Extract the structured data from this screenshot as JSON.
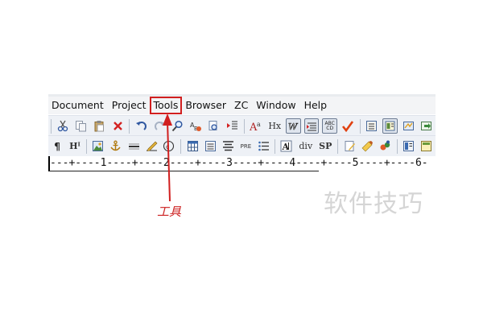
{
  "menubar": {
    "items": [
      {
        "label": "Document"
      },
      {
        "label": "Project"
      },
      {
        "label": "Tools"
      },
      {
        "label": "Browser"
      },
      {
        "label": "ZC"
      },
      {
        "label": "Window"
      },
      {
        "label": "Help"
      }
    ],
    "highlighted_item": "Tools",
    "highlight_color": "#d11f1f"
  },
  "toolbar_row_1": {
    "icons": [
      "cut-icon",
      "copy-icon",
      "paste-icon",
      "delete-icon",
      "undo-icon",
      "redo-icon",
      "find-icon",
      "replace-icon",
      "find-in-files-icon",
      "indent-icon",
      "font-size-icon",
      "hx-heading-icon",
      "word-wrap-icon",
      "line-numbers-icon",
      "spell-check-abc-icon",
      "checkmark-icon",
      "panel-icon",
      "panel-active-icon",
      "preview-icon",
      "export-icon"
    ],
    "text_labels": {
      "hx": "Hx",
      "abc_top": "ABC",
      "abc_bottom": "CD"
    }
  },
  "toolbar_row_2": {
    "icons": [
      "pilcrow-icon",
      "heading-icon",
      "image-icon",
      "anchor-icon",
      "horizontal-rule-icon",
      "edit-icon",
      "copyright-icon",
      "table-icon",
      "list-icon",
      "center-align-icon",
      "pre-icon",
      "bullet-list-icon",
      "font-icon",
      "div-icon",
      "sp-icon",
      "notes-icon",
      "brush-icon",
      "snippet-icon",
      "panel-icon",
      "panel-yellow-icon"
    ],
    "text_labels": {
      "pilcrow": "¶",
      "hi": "Hᴵ",
      "pre": "PRE",
      "div": "div",
      "sp": "SP"
    }
  },
  "ruler": {
    "text": "---+----1----+----2----+----3----+----4----+----5----+----6-"
  },
  "annotation": {
    "label": "工具",
    "color": "#cc1f1f"
  },
  "watermark": {
    "text": "软件技巧"
  }
}
